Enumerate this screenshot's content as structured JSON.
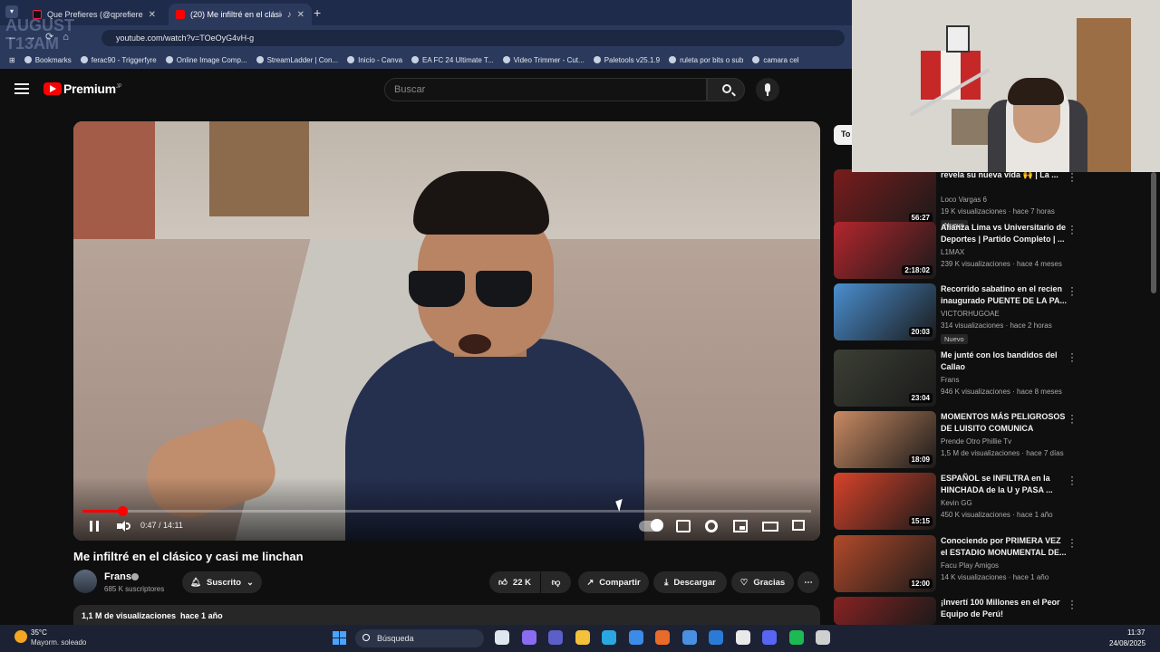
{
  "browser": {
    "tabs": [
      {
        "title": "Que Prefieres (@qprefieresofic",
        "icon": "tiktok-icon"
      },
      {
        "title": "(20) Me infiltré en el clásico",
        "icon": "youtube-icon"
      }
    ],
    "url": "youtube.com/watch?v=TOeOyG4vH-g",
    "bookmarks": [
      "Bookmarks",
      "ferac90 - Triggerfyre",
      "Online Image Comp...",
      "StreamLadder | Con...",
      "Inicio - Canva",
      "EA FC 24 Ultimate T...",
      "Video Trimmer - Cut...",
      "Paletools v25.1.9",
      "ruleta por bits o sub",
      "camara cel"
    ],
    "watermark": "AUGUST\nT13AM"
  },
  "youtube": {
    "brand": "Premium",
    "brand_region": "JP",
    "search_placeholder": "Buscar",
    "player": {
      "time": "0:47 / 14:11",
      "progress": 0.055
    },
    "video_title": "Me infiltré en el clásico y casi me linchan",
    "channel": {
      "name": "Frans",
      "subscribers": "685 K suscriptores"
    },
    "subscribed_label": "Suscrito",
    "likes": "22 K",
    "share_label": "Compartir",
    "download_label": "Descargar",
    "thanks_label": "Gracias",
    "description_stats": "1,1 M de visualizaciones  hace 1 año",
    "sidebar_chip": "To",
    "recommendations": [
      {
        "title": "revela su nueva vida 🙌 | La ...",
        "channel": "Loco Vargas 6",
        "meta": "19 K visualizaciones · hace 7 horas",
        "duration": "56:27",
        "badge": "Nuevo",
        "color": "#7a1c1c"
      },
      {
        "title": "Alianza Lima vs Universitario de Deportes | Partido Completo | ...",
        "channel": "L1MAX",
        "meta": "239 K visualizaciones · hace 4 meses",
        "duration": "2:18:02",
        "badge": "",
        "color": "#b3262d"
      },
      {
        "title": "Recorrido sabatino en el recien inaugurado PUENTE DE LA PA...",
        "channel": "VICTORHUGOAE",
        "meta": "314 visualizaciones · hace 2 horas",
        "duration": "20:03",
        "badge": "Nuevo",
        "color": "#4a8fd0"
      },
      {
        "title": "Me junté con los bandidos del Callao",
        "channel": "Frans",
        "meta": "946 K visualizaciones · hace 8 meses",
        "duration": "23:04",
        "badge": "",
        "color": "#3c3f35"
      },
      {
        "title": "MOMENTOS MÁS PELIGROSOS DE LUISITO COMUNICA",
        "channel": "Prende Otro Phillie Tv",
        "meta": "1,5 M de visualizaciones · hace 7 días",
        "duration": "18:09",
        "badge": "",
        "color": "#c98a63"
      },
      {
        "title": "ESPAÑOL se INFILTRA en la HINCHADA de la U y PASA ...",
        "channel": "Kevin GG",
        "meta": "450 K visualizaciones · hace 1 año",
        "duration": "15:15",
        "badge": "",
        "color": "#d8432a"
      },
      {
        "title": "Conociendo por PRIMERA VEZ el ESTADIO MONUMENTAL DE...",
        "channel": "Facu Play Amigos",
        "meta": "14 K visualizaciones · hace 1 año",
        "duration": "12:00",
        "badge": "",
        "color": "#b34a2a"
      },
      {
        "title": "¡Invertí 100 Millones en el Peor Equipo de Perú!",
        "channel": "",
        "meta": "",
        "duration": "",
        "badge": "",
        "color": "#8a2222"
      }
    ]
  },
  "taskbar": {
    "weather_temp": "35°C",
    "weather_desc": "Mayorm. soleado",
    "search_label": "Búsqueda",
    "clock_time": "11:37",
    "clock_date": "24/08/2025",
    "apps": [
      "file-explorer-icon",
      "copilot-icon",
      "teams-icon",
      "folder-icon",
      "edge-icon",
      "store-icon",
      "app-icon",
      "mail-icon",
      "photos-icon",
      "chrome-icon",
      "discord-icon",
      "spotify-icon",
      "obs-icon"
    ]
  }
}
